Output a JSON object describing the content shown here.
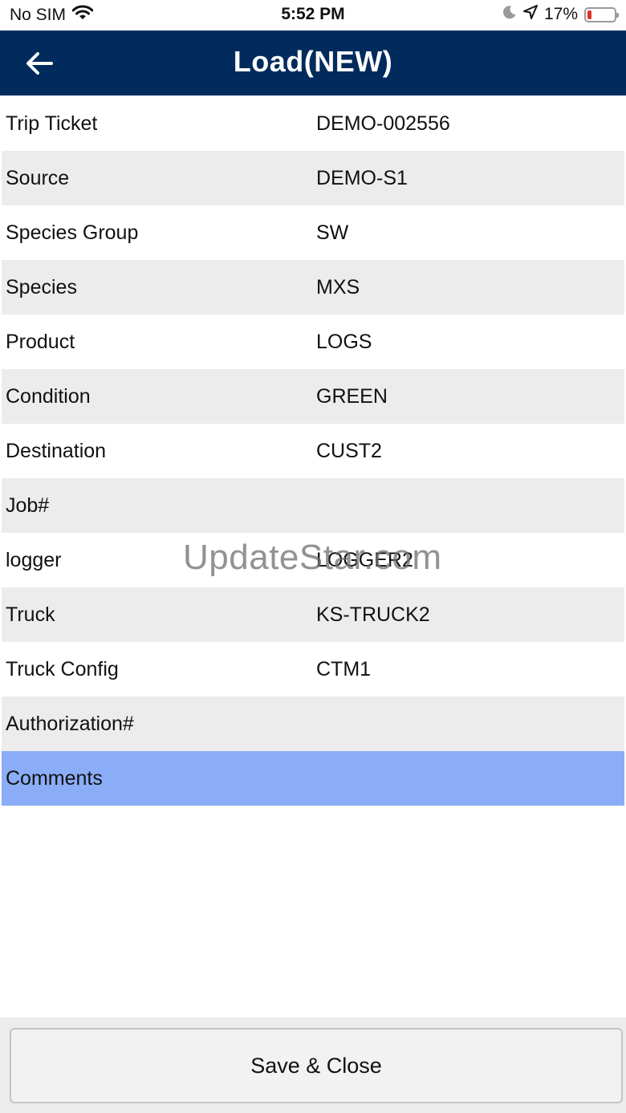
{
  "status_bar": {
    "carrier": "No SIM",
    "time": "5:52 PM",
    "battery_percent_text": "17%",
    "battery_level": 0.17,
    "battery_color": "#e0302c"
  },
  "header": {
    "title": "Load(NEW)",
    "background_color": "#002b5c"
  },
  "rows": [
    {
      "label": "Trip Ticket",
      "value": "DEMO-002556"
    },
    {
      "label": "Source",
      "value": "DEMO-S1"
    },
    {
      "label": "Species Group",
      "value": "SW"
    },
    {
      "label": "Species",
      "value": "MXS"
    },
    {
      "label": "Product",
      "value": "LOGS"
    },
    {
      "label": "Condition",
      "value": "GREEN"
    },
    {
      "label": "Destination",
      "value": "CUST2"
    },
    {
      "label": "Job#",
      "value": ""
    },
    {
      "label": "logger",
      "value": "LOGGER2"
    },
    {
      "label": "Truck",
      "value": "KS-TRUCK2"
    },
    {
      "label": "Truck Config",
      "value": "CTM1"
    },
    {
      "label": "Authorization#",
      "value": ""
    },
    {
      "label": "Comments",
      "value": ""
    }
  ],
  "selected_row_label": "Comments",
  "selected_row_color": "#8badf7",
  "watermark": "UpdateStar.com",
  "footer": {
    "save_close_label": "Save & Close"
  }
}
